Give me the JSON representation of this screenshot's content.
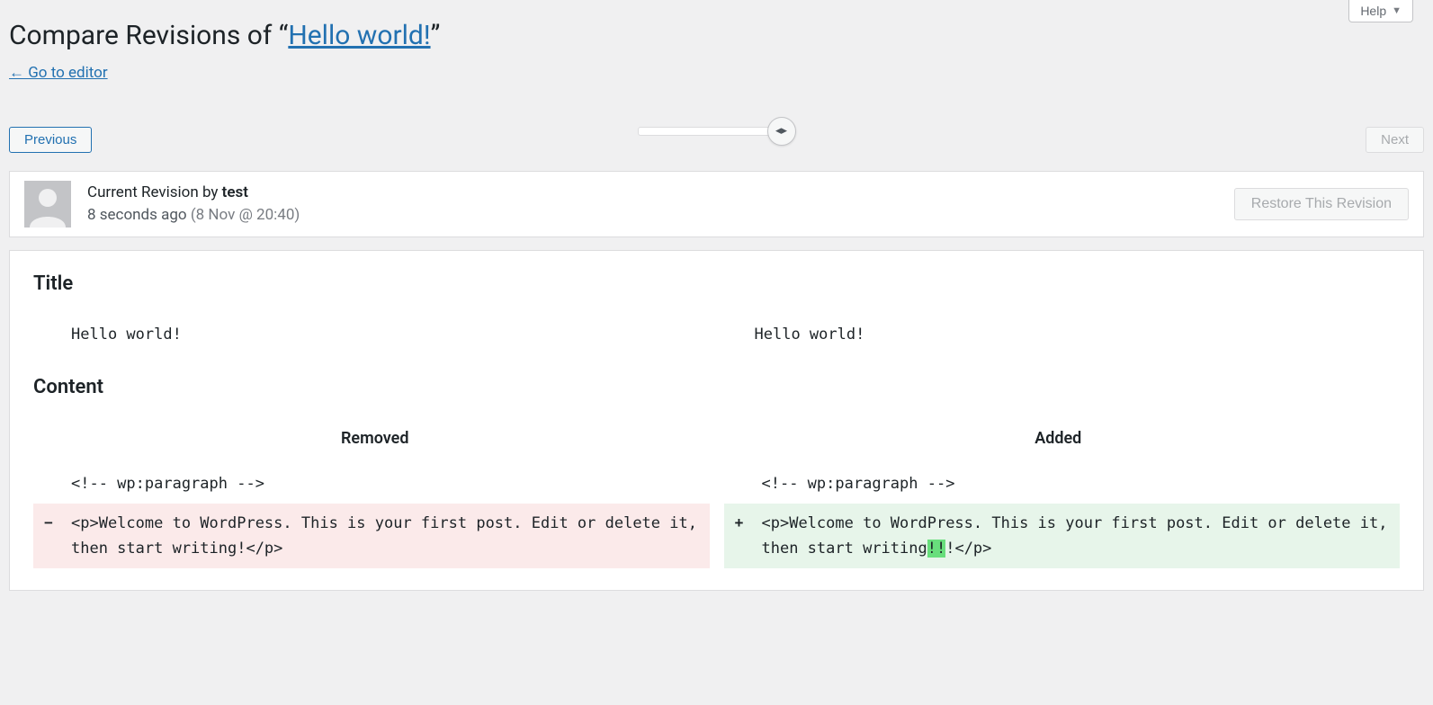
{
  "help": {
    "label": "Help"
  },
  "header": {
    "prefix": "Compare Revisions of “",
    "link_text": "Hello world!",
    "suffix": "”",
    "editor_link": "← Go to editor"
  },
  "nav": {
    "previous": "Previous",
    "next": "Next"
  },
  "meta": {
    "label_prefix": "Current Revision by ",
    "author": "test",
    "time_ago": "8 seconds ago",
    "timestamp": "(8 Nov @ 20:40)",
    "restore_label": "Restore This Revision"
  },
  "diff": {
    "title_section": "Title",
    "title_left": "Hello world!",
    "title_right": "Hello world!",
    "content_section": "Content",
    "removed_header": "Removed",
    "added_header": "Added",
    "context_left": "<!-- wp:paragraph -->",
    "context_right": "<!-- wp:paragraph -->",
    "removed_line": "<p>Welcome to WordPress. This is your first post. Edit or delete it, then start writing!</p>",
    "added_pre": "<p>Welcome to WordPress. This is your first post. Edit or delete it, then start writing",
    "added_ins": "!!",
    "added_post": "!</p>",
    "minus": "−",
    "plus": "+"
  }
}
